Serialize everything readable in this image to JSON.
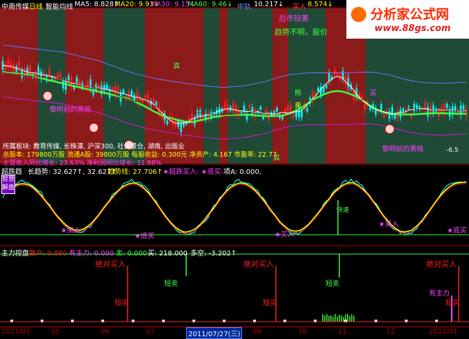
{
  "topbar": {
    "stock_name": "中南传媒",
    "period": "日线",
    "indicator": "智能均线",
    "ma5": "MA5: 8.828↑",
    "ma20": "MA20: 9.93↓",
    "ma30": "MA30: 9.15↓",
    "ma60": "MA60: 9.46↓",
    "mid_label": "中轨",
    "mid_value": "10.217↓",
    "buy_label": "买入",
    "last_value": "8.574↓"
  },
  "watermark": {
    "title": "分析家公式网",
    "url": "www.88gs.com"
  },
  "main_panel": {
    "annotations": {
      "warn": "后市较差",
      "trend": "趋势不明，股价",
      "true_top": "真",
      "true_bottom": "真",
      "sell_mid": "卖",
      "buy_red": "买",
      "sell_left": "熊",
      "dawn_left": "黎明前的黑暗",
      "dawn_right": "黎明前的黑暗",
      "pct": "-6.5",
      "right_red": "买"
    },
    "info_lines": [
      "所属板块: 教育传媒, 长株潭, 沪深300, 社保重仓, 湖南, 出版业",
      "总股本: 179800万股  流通A股: 39800万股  每股收益: 0.300元  净资产: 4.167  市盈率: 22.77",
      "主营收入同比增长: 23.63%  净利润同比增长: 31.88%"
    ]
  },
  "mid_panel": {
    "title": "超跌趋",
    "long_trend": "长趋势: 32.627↑, 32.627↑",
    "trend_line": "趋势线: 27.706↑",
    "oversold": "★超跌买入: ★底买:",
    "item_a": "项A: 0.000,",
    "side_tag_1": "智慧",
    "side_tag_2": "解盘",
    "marks": {
      "buy1": "★买入",
      "bottom1": "★底买",
      "buy2": "★买入",
      "sell_tag": "快速",
      "buy3": "★买入",
      "bottom3": "★底买"
    }
  },
  "low_panel": {
    "title": "主力控盘",
    "retail": "散户: 0.000",
    "main_force": "有主力: 0.000",
    "sell": "卖: 0.000",
    "buy": "买: 218.000",
    "long_short": "多空: -3.202↑",
    "absolute_buy": "绝对买入",
    "short_buy": "短买",
    "stop_short": "短卖",
    "main_force_tag": "有主力"
  },
  "xaxis": {
    "labels": [
      "2011/03",
      "05",
      "06",
      "07",
      "2011/07/27(三)",
      "09",
      "10",
      "11",
      "12",
      "2012/01"
    ],
    "cursor_date": "2011/07/27(三)"
  },
  "colors": {
    "background": "#000000",
    "red_band": "#8b1a1a",
    "green_band": "#1f4a36",
    "panel_border": "#b00000",
    "yellow": "#ffff00",
    "cyan": "#00ffff",
    "red": "#ff2020",
    "magenta": "#ff40ff",
    "green": "#40ff40",
    "watermark_red": "#ff2a00"
  }
}
